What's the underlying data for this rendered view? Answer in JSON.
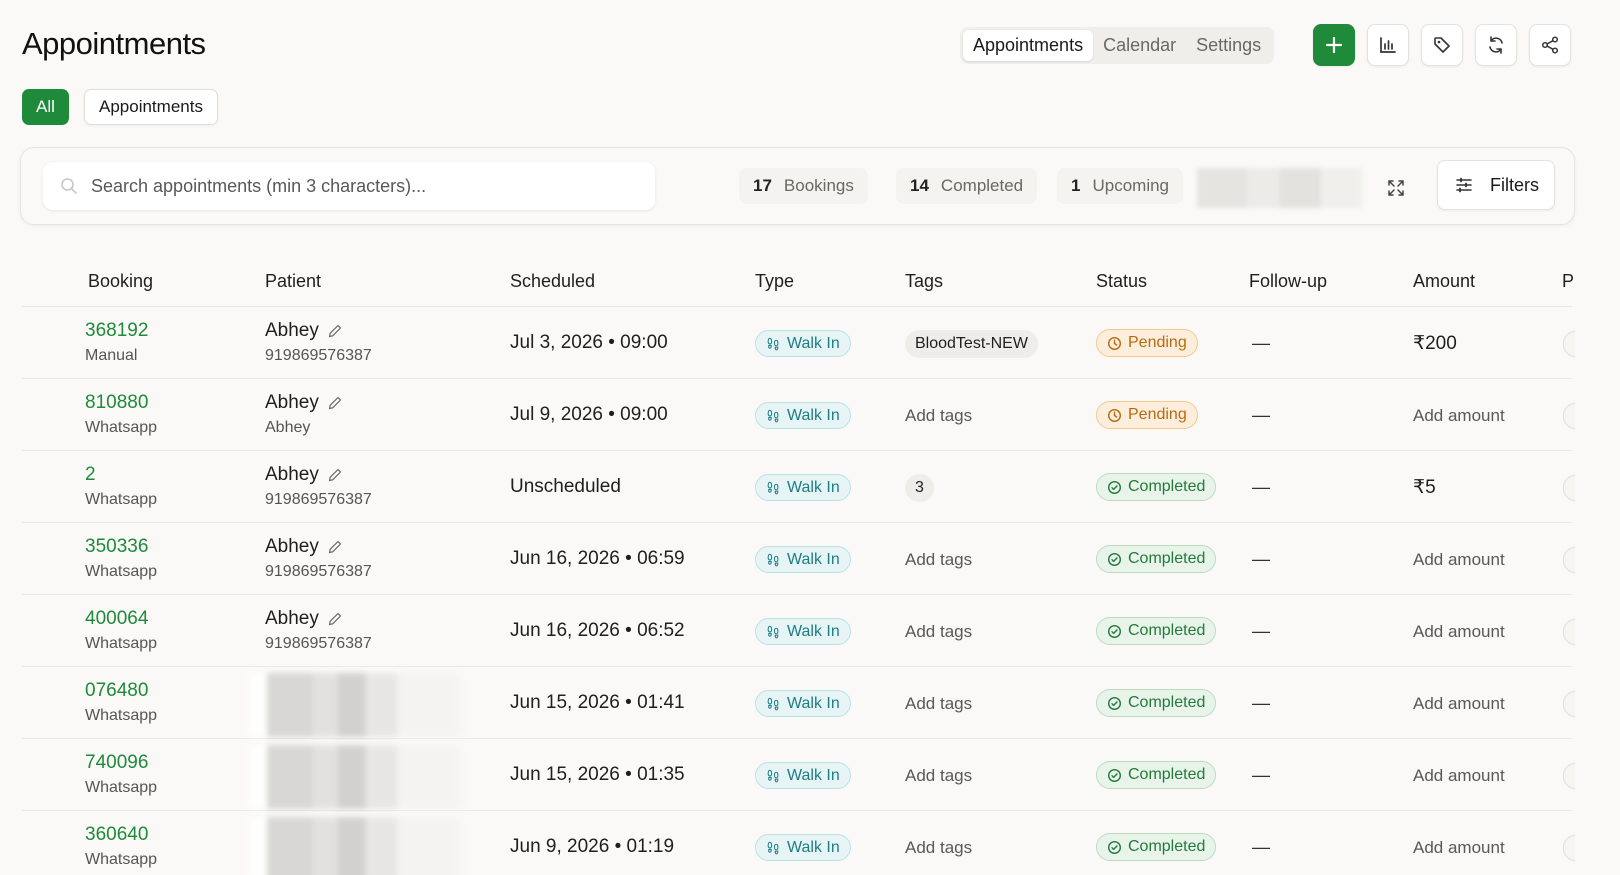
{
  "header": {
    "title": "Appointments",
    "nav_tabs": [
      {
        "label": "Appointments",
        "active": true
      },
      {
        "label": "Calendar",
        "active": false
      },
      {
        "label": "Settings",
        "active": false
      }
    ],
    "icons": [
      "plus-icon",
      "chart-icon",
      "tag-icon",
      "refresh-icon",
      "share-icon"
    ]
  },
  "filter_chips": {
    "all_label": "All",
    "appointments_label": "Appointments"
  },
  "toolbar": {
    "search_placeholder": "Search appointments (min 3 characters)...",
    "stats": {
      "bookings": {
        "count": "17",
        "label": "Bookings"
      },
      "completed": {
        "count": "14",
        "label": "Completed"
      },
      "upcoming": {
        "count": "1",
        "label": "Upcoming"
      }
    },
    "filters_label": "Filters"
  },
  "table": {
    "columns": {
      "booking": "Booking",
      "patient": "Patient",
      "scheduled": "Scheduled",
      "type": "Type",
      "tags": "Tags",
      "status": "Status",
      "followup": "Follow-up",
      "amount": "Amount",
      "p": "P"
    },
    "rows": [
      {
        "id": "368192",
        "source": "Manual",
        "patient": "Abhey",
        "patient_sub": "919869576387",
        "scheduled": "Jul 3, 2026 • 09:00",
        "type": "Walk In",
        "tags": "BloodTest-NEW",
        "tag_is_pill": true,
        "status": "Pending",
        "followup": "—",
        "amount": "₹200",
        "amount_is_value": true
      },
      {
        "id": "810880",
        "source": "Whatsapp",
        "patient": "Abhey",
        "patient_sub": "Abhey",
        "scheduled": "Jul 9, 2026 • 09:00",
        "type": "Walk In",
        "tags": "Add tags",
        "tag_is_pill": false,
        "status": "Pending",
        "followup": "—",
        "amount": "Add amount",
        "amount_is_value": false
      },
      {
        "id": "2",
        "source": "Whatsapp",
        "patient": "Abhey",
        "patient_sub": "919869576387",
        "scheduled": "Unscheduled",
        "type": "Walk In",
        "tags": "3",
        "tag_is_pill": true,
        "status": "Completed",
        "followup": "—",
        "amount": "₹5",
        "amount_is_value": true
      },
      {
        "id": "350336",
        "source": "Whatsapp",
        "patient": "Abhey",
        "patient_sub": "919869576387",
        "scheduled": "Jun 16, 2026 • 06:59",
        "type": "Walk In",
        "tags": "Add tags",
        "tag_is_pill": false,
        "status": "Completed",
        "followup": "—",
        "amount": "Add amount",
        "amount_is_value": false
      },
      {
        "id": "400064",
        "source": "Whatsapp",
        "patient": "Abhey",
        "patient_sub": "919869576387",
        "scheduled": "Jun 16, 2026 • 06:52",
        "type": "Walk In",
        "tags": "Add tags",
        "tag_is_pill": false,
        "status": "Completed",
        "followup": "—",
        "amount": "Add amount",
        "amount_is_value": false
      },
      {
        "id": "076480",
        "source": "Whatsapp",
        "patient": "",
        "patient_sub": "",
        "scheduled": "Jun 15, 2026 • 01:41",
        "type": "Walk In",
        "tags": "Add tags",
        "tag_is_pill": false,
        "status": "Completed",
        "followup": "—",
        "amount": "Add amount",
        "amount_is_value": false
      },
      {
        "id": "740096",
        "source": "Whatsapp",
        "patient": "",
        "patient_sub": "",
        "scheduled": "Jun 15, 2026 • 01:35",
        "type": "Walk In",
        "tags": "Add tags",
        "tag_is_pill": false,
        "status": "Completed",
        "followup": "—",
        "amount": "Add amount",
        "amount_is_value": false
      },
      {
        "id": "360640",
        "source": "Whatsapp",
        "patient": "",
        "patient_sub": "",
        "scheduled": "Jun 9, 2026 • 01:19",
        "type": "Walk In",
        "tags": "Add tags",
        "tag_is_pill": false,
        "status": "Completed",
        "followup": "—",
        "amount": "Add amount",
        "amount_is_value": false
      }
    ]
  },
  "colors": {
    "brand_green": "#1e8a3a",
    "pending": "#b86a12",
    "completed": "#247a3b",
    "walk_in": "#1d7d86"
  }
}
